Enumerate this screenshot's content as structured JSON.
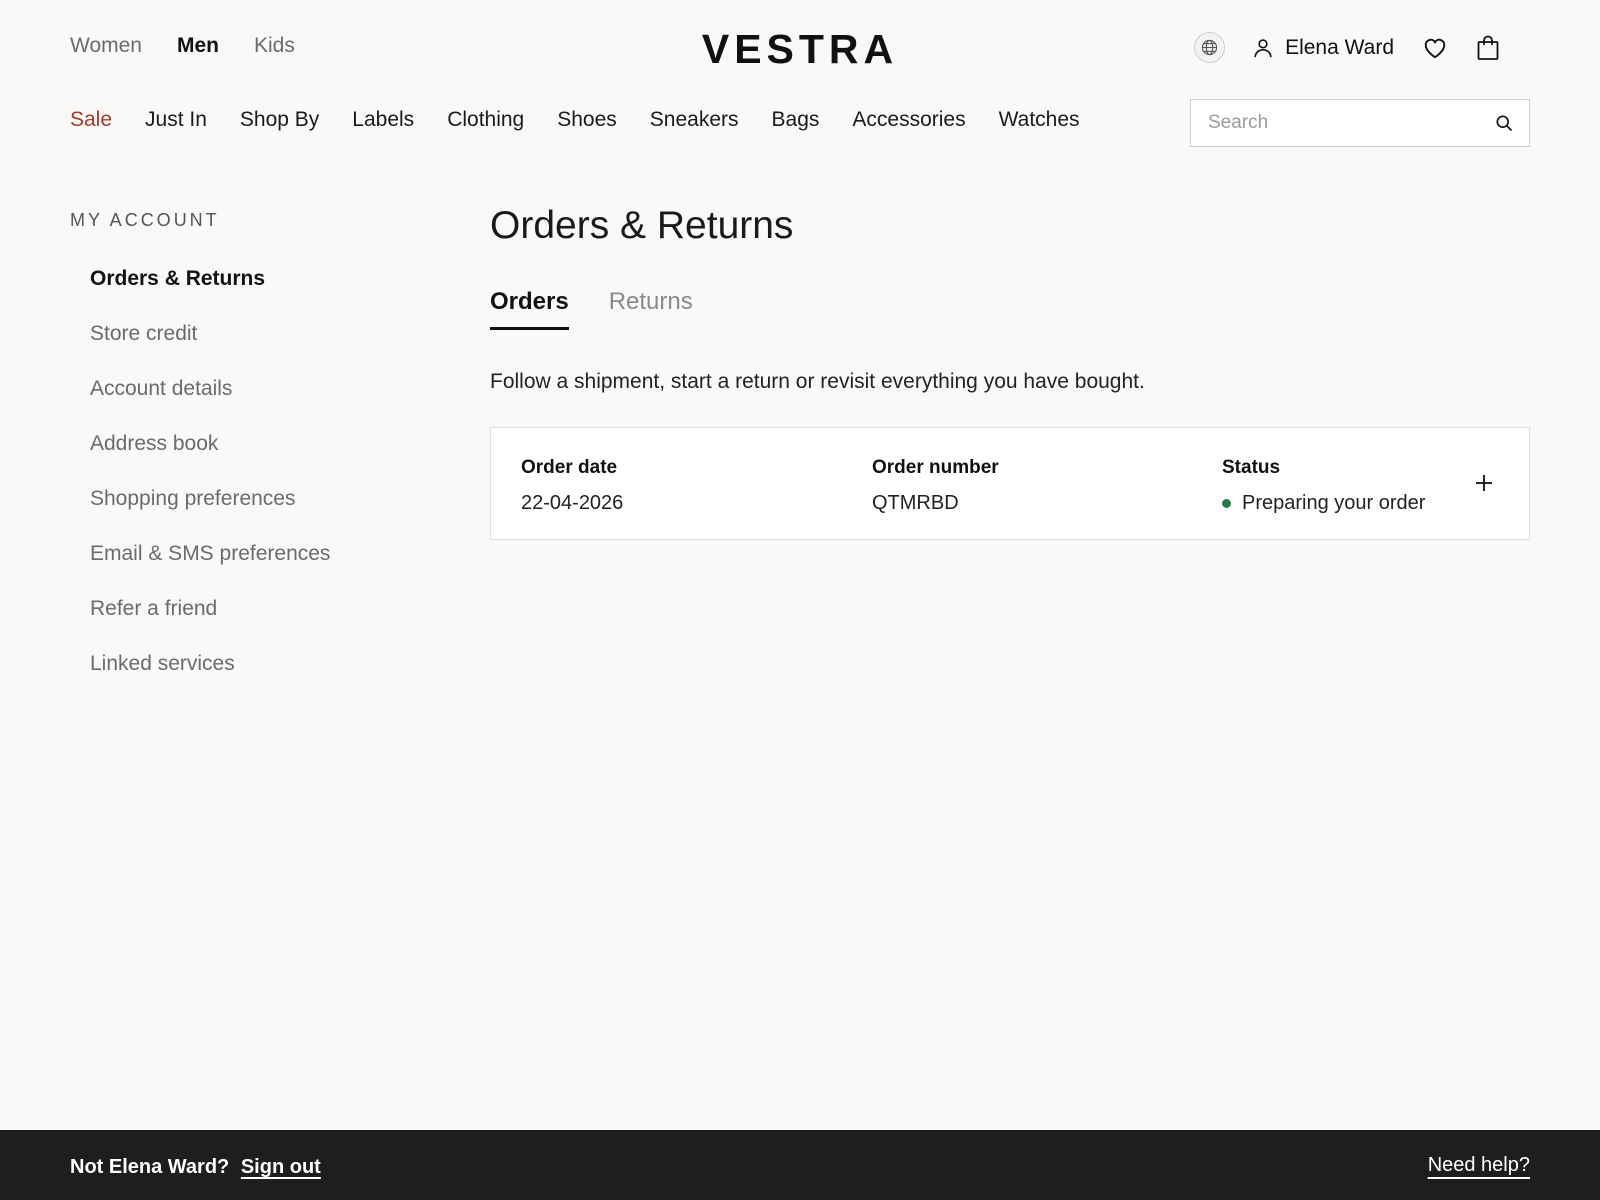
{
  "header": {
    "departments": [
      {
        "label": "Women",
        "active": false
      },
      {
        "label": "Men",
        "active": true
      },
      {
        "label": "Kids",
        "active": false
      }
    ],
    "logo": "VESTRA",
    "user_name": "Elena Ward",
    "icons": {
      "globe": "globe-icon",
      "user": "user-icon",
      "wishlist": "heart-icon",
      "bag": "shopping-bag-icon",
      "search": "search-icon"
    }
  },
  "nav": {
    "categories": [
      "Sale",
      "Just In",
      "Shop By",
      "Labels",
      "Clothing",
      "Shoes",
      "Sneakers",
      "Bags",
      "Accessories",
      "Watches"
    ],
    "search_placeholder": "Search"
  },
  "sidebar": {
    "title": "MY ACCOUNT",
    "items": [
      {
        "label": "Orders & Returns",
        "active": true
      },
      {
        "label": "Store credit",
        "active": false
      },
      {
        "label": "Account details",
        "active": false
      },
      {
        "label": "Address book",
        "active": false
      },
      {
        "label": "Shopping preferences",
        "active": false
      },
      {
        "label": "Email & SMS preferences",
        "active": false
      },
      {
        "label": "Refer a friend",
        "active": false
      },
      {
        "label": "Linked services",
        "active": false
      }
    ]
  },
  "main": {
    "title": "Orders & Returns",
    "tabs": [
      {
        "label": "Orders",
        "active": true
      },
      {
        "label": "Returns",
        "active": false
      }
    ],
    "intro": "Follow a shipment, start a return or revisit everything you have bought.",
    "order": {
      "date_label": "Order date",
      "date_value": "22-04-2026",
      "number_label": "Order number",
      "number_value": "QTMRBD",
      "status_label": "Status",
      "status_value": "Preparing your order"
    }
  },
  "footer": {
    "prompt": "Not Elena Ward?",
    "signout": "Sign out",
    "help": "Need help?"
  },
  "colors": {
    "background": "#faf9f7",
    "sale": "#a63a28",
    "status_dot": "#2f7a4d",
    "footer_bg": "#1e1e1e"
  }
}
